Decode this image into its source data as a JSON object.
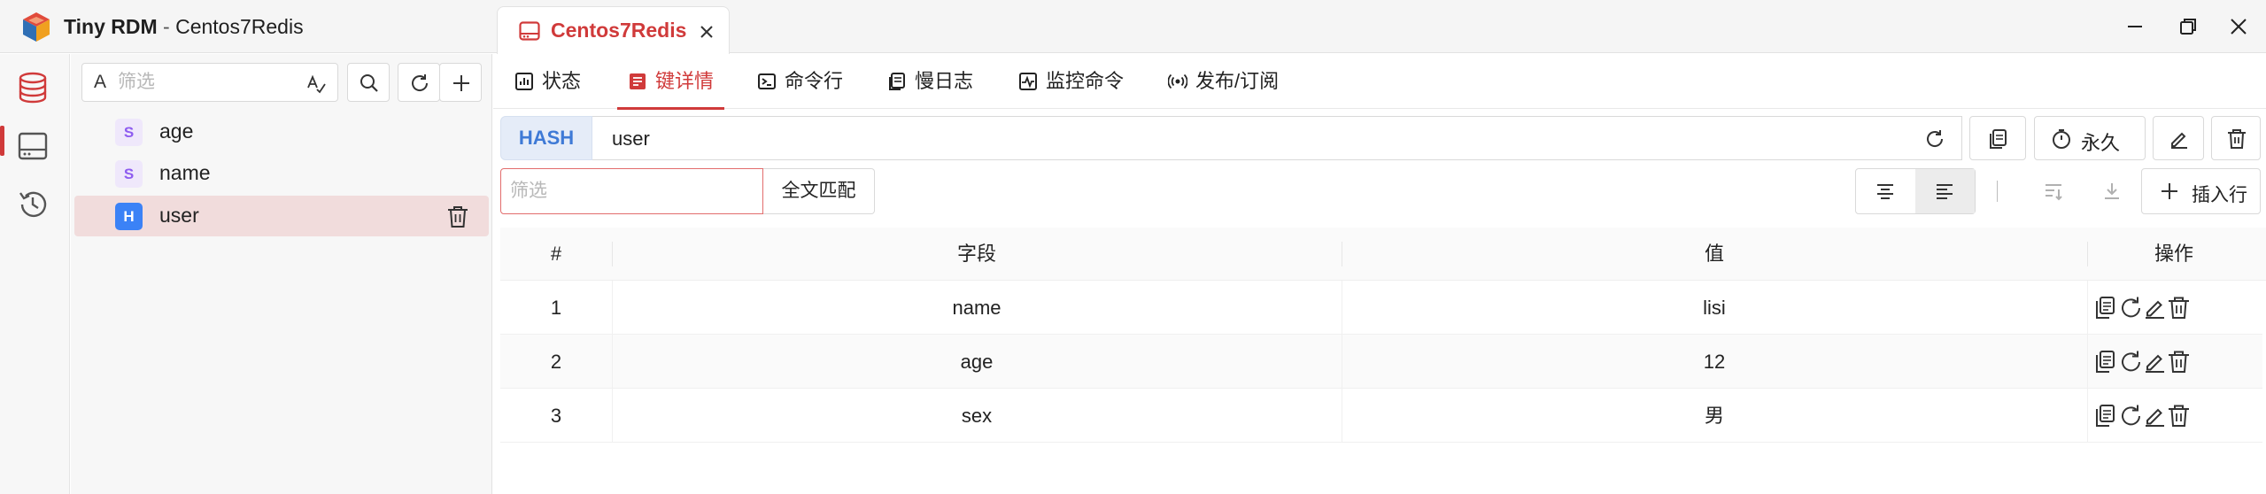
{
  "window": {
    "app_name": "Tiny RDM",
    "separator": " - ",
    "connection_title": "Centos7Redis"
  },
  "connection_tab": {
    "label": "Centos7Redis"
  },
  "browser": {
    "filter_prefix": "A",
    "filter_placeholder": "筛选",
    "keys": [
      {
        "type": "S",
        "name": "age"
      },
      {
        "type": "S",
        "name": "name"
      },
      {
        "type": "H",
        "name": "user"
      }
    ]
  },
  "subtabs": [
    {
      "label": "状态",
      "icon": "status-icon"
    },
    {
      "label": "键详情",
      "icon": "key-detail-icon"
    },
    {
      "label": "命令行",
      "icon": "terminal-icon"
    },
    {
      "label": "慢日志",
      "icon": "slowlog-icon"
    },
    {
      "label": "监控命令",
      "icon": "monitor-icon"
    },
    {
      "label": "发布/订阅",
      "icon": "pubsub-icon"
    }
  ],
  "key_detail": {
    "type": "HASH",
    "key": "user",
    "ttl_label": "永久",
    "value_filter_placeholder": "筛选",
    "match_label": "全文匹配",
    "insert_label": "插入行",
    "columns": [
      "#",
      "字段",
      "值",
      "操作"
    ],
    "rows": [
      {
        "index": "1",
        "field": "name",
        "value": "lisi"
      },
      {
        "index": "2",
        "field": "age",
        "value": "12"
      },
      {
        "index": "3",
        "field": "sex",
        "value": "男"
      }
    ]
  },
  "colors": {
    "accent": "#d03a3a",
    "hash_badge": "#3b82f6",
    "string_badge": "#8e5cf0"
  }
}
